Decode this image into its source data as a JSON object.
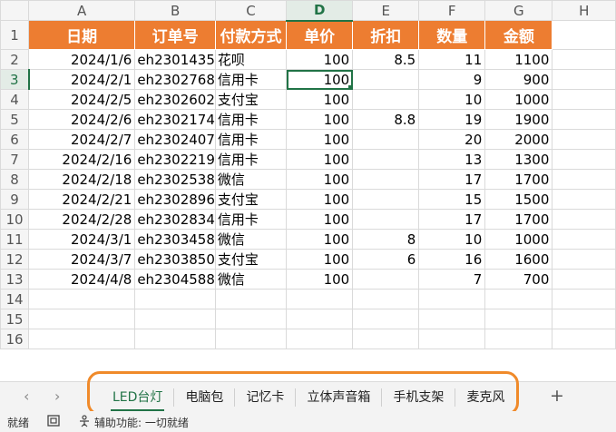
{
  "columns": [
    "A",
    "B",
    "C",
    "D",
    "E",
    "F",
    "G",
    "H"
  ],
  "rows": [
    "1",
    "2",
    "3",
    "4",
    "5",
    "6",
    "7",
    "8",
    "9",
    "10",
    "11",
    "12",
    "13",
    "14",
    "15",
    "16"
  ],
  "headers": [
    "日期",
    "订单号",
    "付款方式",
    "单价",
    "折扣",
    "数量",
    "金额"
  ],
  "records": [
    {
      "date": "2024/1/6",
      "order": "eh2301435",
      "pay": "花呗",
      "price": "100",
      "disc": "8.5",
      "qty": "11",
      "amt": "1100"
    },
    {
      "date": "2024/2/1",
      "order": "eh2302768",
      "pay": "信用卡",
      "price": "100",
      "disc": "",
      "qty": "9",
      "amt": "900"
    },
    {
      "date": "2024/2/5",
      "order": "eh2302602",
      "pay": "支付宝",
      "price": "100",
      "disc": "",
      "qty": "10",
      "amt": "1000"
    },
    {
      "date": "2024/2/6",
      "order": "eh2302174",
      "pay": "信用卡",
      "price": "100",
      "disc": "8.8",
      "qty": "19",
      "amt": "1900"
    },
    {
      "date": "2024/2/7",
      "order": "eh2302407",
      "pay": "信用卡",
      "price": "100",
      "disc": "",
      "qty": "20",
      "amt": "2000"
    },
    {
      "date": "2024/2/16",
      "order": "eh2302219",
      "pay": "信用卡",
      "price": "100",
      "disc": "",
      "qty": "13",
      "amt": "1300"
    },
    {
      "date": "2024/2/18",
      "order": "eh2302538",
      "pay": "微信",
      "price": "100",
      "disc": "",
      "qty": "17",
      "amt": "1700"
    },
    {
      "date": "2024/2/21",
      "order": "eh2302896",
      "pay": "支付宝",
      "price": "100",
      "disc": "",
      "qty": "15",
      "amt": "1500"
    },
    {
      "date": "2024/2/28",
      "order": "eh2302834",
      "pay": "信用卡",
      "price": "100",
      "disc": "",
      "qty": "17",
      "amt": "1700"
    },
    {
      "date": "2024/3/1",
      "order": "eh2303458",
      "pay": "微信",
      "price": "100",
      "disc": "8",
      "qty": "10",
      "amt": "1000"
    },
    {
      "date": "2024/3/7",
      "order": "eh2303850",
      "pay": "支付宝",
      "price": "100",
      "disc": "6",
      "qty": "16",
      "amt": "1600"
    },
    {
      "date": "2024/4/8",
      "order": "eh2304588",
      "pay": "微信",
      "price": "100",
      "disc": "",
      "qty": "7",
      "amt": "700"
    }
  ],
  "tabbar": {
    "prev_icon": "‹",
    "next_icon": "›",
    "tabs": [
      "LED台灯",
      "电脑包",
      "记忆卡",
      "立体声音箱",
      "手机支架",
      "麦克风"
    ],
    "active_tab": "LED台灯",
    "add_label": "+"
  },
  "status": {
    "ready": "就绪",
    "accessibility": "辅助功能: 一切就绪"
  },
  "colors": {
    "header_fill": "#ed7d31",
    "selection": "#217346",
    "highlight": "#f08a2a"
  }
}
